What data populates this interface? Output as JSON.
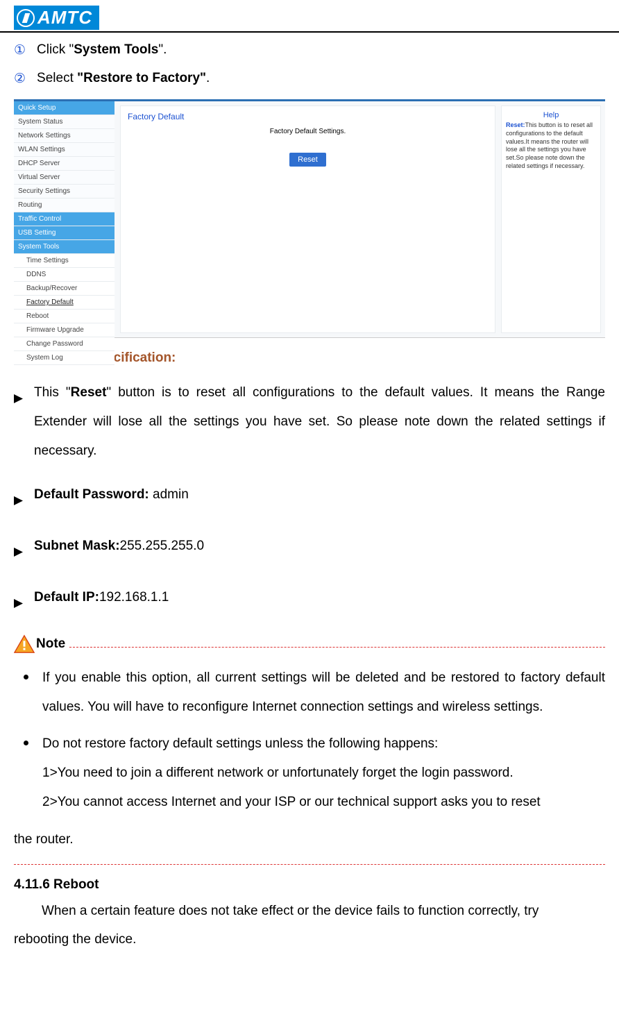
{
  "logo": "AMTC",
  "steps": {
    "one": {
      "num": "①",
      "pre": "Click \"",
      "bold": "System Tools",
      "post": "\"."
    },
    "two": {
      "num": "②",
      "pre": "Select ",
      "bold": "\"Restore to Factory\"",
      "post": "."
    }
  },
  "router": {
    "sidebar": {
      "quick_setup": "Quick Setup",
      "system_status": "System Status",
      "network_settings": "Network Settings",
      "wlan_settings": "WLAN Settings",
      "dhcp_server": "DHCP Server",
      "virtual_server": "Virtual Server",
      "security_settings": "Security Settings",
      "routing": "Routing",
      "traffic_control": "Traffic Control",
      "usb_setting": "USB Setting",
      "system_tools": "System Tools",
      "time_settings": "Time Settings",
      "ddns": "DDNS",
      "backup_recover": "Backup/Recover",
      "factory_default": "Factory Default",
      "reboot": "Reboot",
      "firmware_upgrade": "Firmware Upgrade",
      "change_password": "Change Password",
      "system_log": "System Log"
    },
    "main": {
      "title": "Factory Default",
      "sub": "Factory Default Settings.",
      "button": "Reset"
    },
    "help": {
      "title": "Help",
      "label": "Reset:",
      "text": "This button is to reset all configurations to the default values.It means the router will lose all the settings you have set.So please note down the related settings if necessary."
    }
  },
  "params": {
    "heading": "Parameters Specification:",
    "item1": {
      "pre": "This \"",
      "bold": "Reset",
      "post": "\" button is to reset all configurations to the default values. It means the Range Extender will lose all the settings you have set. So please note down the related settings if necessary."
    },
    "item2": {
      "label": "Default Password: ",
      "value": "admin"
    },
    "item3": {
      "label": "Subnet Mask:",
      "value": "255.255.255.0"
    },
    "item4": {
      "label": "Default IP:",
      "value": "192.168.1.1"
    }
  },
  "note": {
    "label": "Note",
    "b1": "If you enable this option, all current settings will be deleted and be restored to factory default values. You will have to reconfigure Internet connection settings and wireless settings.",
    "b2": "Do not restore factory default settings unless the following happens:",
    "b2_1": "1>You need to join a different network or unfortunately forget the login password.",
    "b2_2": "2>You cannot access Internet and your ISP or our technical support asks you to reset",
    "trail": "the router."
  },
  "section": {
    "head": "4.11.6 Reboot",
    "body1": "When a certain feature does not take effect or the device fails to function correctly, try",
    "body2": "rebooting the device."
  }
}
